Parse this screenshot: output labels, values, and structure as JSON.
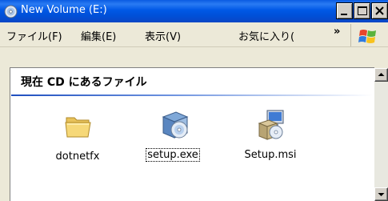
{
  "window": {
    "title": "New Volume (E:)",
    "title_icon": "cd-drive-icon",
    "buttons": {
      "minimize_icon": "minimize-icon",
      "maximize_icon": "maximize-icon",
      "close_icon": "close-icon"
    }
  },
  "menubar": {
    "items": [
      {
        "label": "ファイル(F)"
      },
      {
        "label": "編集(E)"
      },
      {
        "label": "表示(V)"
      },
      {
        "label": "お気に入り("
      }
    ],
    "overflow": "»",
    "logo_icon": "windows-logo-icon"
  },
  "group": {
    "header": "現在 CD にあるファイル"
  },
  "files": [
    {
      "name": "dotnetfx",
      "icon": "folder-icon",
      "selected": false
    },
    {
      "name": "setup.exe",
      "icon": "setup-exe-icon",
      "selected": true
    },
    {
      "name": "Setup.msi",
      "icon": "msi-package-icon",
      "selected": false
    }
  ],
  "colors": {
    "titlebar": "#0054e3",
    "chrome": "#ece9d8",
    "group_line": "#1f4fbf"
  }
}
